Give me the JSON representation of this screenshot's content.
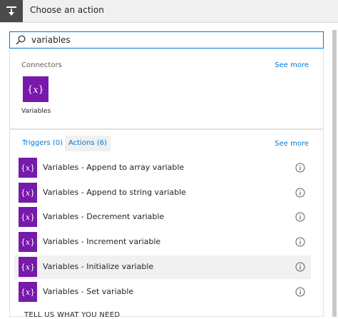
{
  "header": {
    "title": "Choose an action",
    "icon": "action-step-icon"
  },
  "search": {
    "value": "variables",
    "icon": "search-icon"
  },
  "connectors": {
    "section_label": "Connectors",
    "see_more": "See more",
    "items": [
      {
        "label": "Variables",
        "icon": "variables-icon",
        "color": "#7719aa"
      }
    ]
  },
  "actions": {
    "tabs": [
      {
        "label": "Triggers (0)",
        "active": false
      },
      {
        "label": "Actions (6)",
        "active": true
      }
    ],
    "see_more": "See more",
    "items": [
      {
        "label": "Variables - Append to array variable"
      },
      {
        "label": "Variables - Append to string variable"
      },
      {
        "label": "Variables - Decrement variable"
      },
      {
        "label": "Variables - Increment variable"
      },
      {
        "label": "Variables - Initialize variable",
        "highlighted": true
      },
      {
        "label": "Variables - Set variable"
      }
    ],
    "footer": "TELL US WHAT YOU NEED"
  },
  "colors": {
    "accent": "#0078d4",
    "connector_purple": "#7719aa",
    "header_bg": "#f0f0f0",
    "header_icon_bg": "#4a4a4a"
  }
}
